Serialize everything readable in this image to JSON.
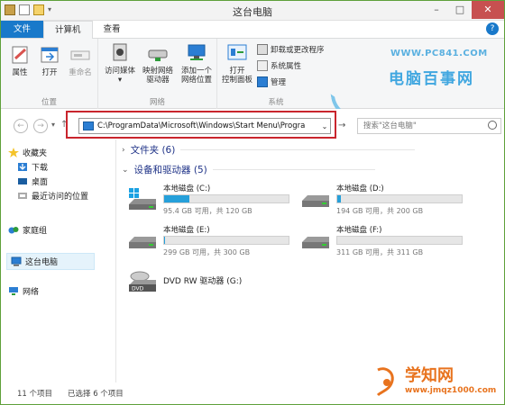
{
  "window": {
    "title": "这台电脑"
  },
  "tabs": [
    "文件",
    "计算机",
    "查看"
  ],
  "ribbon": {
    "location": {
      "label": "位置",
      "buttons": [
        "属性",
        "打开",
        "重命名"
      ]
    },
    "network": {
      "label": "网络",
      "buttons": [
        {
          "l1": "访问媒体",
          "l2": ""
        },
        {
          "l1": "映射网络",
          "l2": "驱动器"
        },
        {
          "l1": "添加一个",
          "l2": "网络位置"
        }
      ]
    },
    "system": {
      "label": "系统",
      "open_l1": "打开",
      "open_l2": "控制面板",
      "items": [
        "卸载或更改程序",
        "系统属性",
        "管理"
      ]
    }
  },
  "watermark": {
    "url": "WWW.PC841.COM",
    "name": "电脑百事网",
    "site": "学知网",
    "site_url": "www.jmqz1000.com"
  },
  "address": {
    "path": "C:\\ProgramData\\Microsoft\\Windows\\Start Menu\\Progra"
  },
  "search": {
    "placeholder": "搜索\"这台电脑\""
  },
  "nav": {
    "favorites": "收藏夹",
    "favorite_items": [
      "下载",
      "桌面",
      "最近访问的位置"
    ],
    "homegroup": "家庭组",
    "this_pc": "这台电脑",
    "network": "网络"
  },
  "content": {
    "folders_group": "文件夹 (6)",
    "drives_group": "设备和驱动器 (5)",
    "drives": [
      {
        "name": "本地磁盘 (C:)",
        "info": "95.4 GB 可用，共 120 GB",
        "used_fraction": 0.205
      },
      {
        "name": "本地磁盘 (D:)",
        "info": "194 GB 可用，共 200 GB",
        "used_fraction": 0.03
      },
      {
        "name": "本地磁盘 (E:)",
        "info": "299 GB 可用，共 300 GB",
        "used_fraction": 0.003
      },
      {
        "name": "本地磁盘 (F:)",
        "info": "311 GB 可用，共 311 GB",
        "used_fraction": 0.0
      },
      {
        "name": "DVD RW 驱动器 (G:)",
        "info": "",
        "used_fraction": null
      }
    ]
  },
  "status": {
    "count": "11 个项目",
    "selected": "已选择 6 个项目"
  },
  "colors": {
    "accent": "#1979ca",
    "bar_fill": "#26a0da",
    "highlight_box": "#c9252d"
  }
}
